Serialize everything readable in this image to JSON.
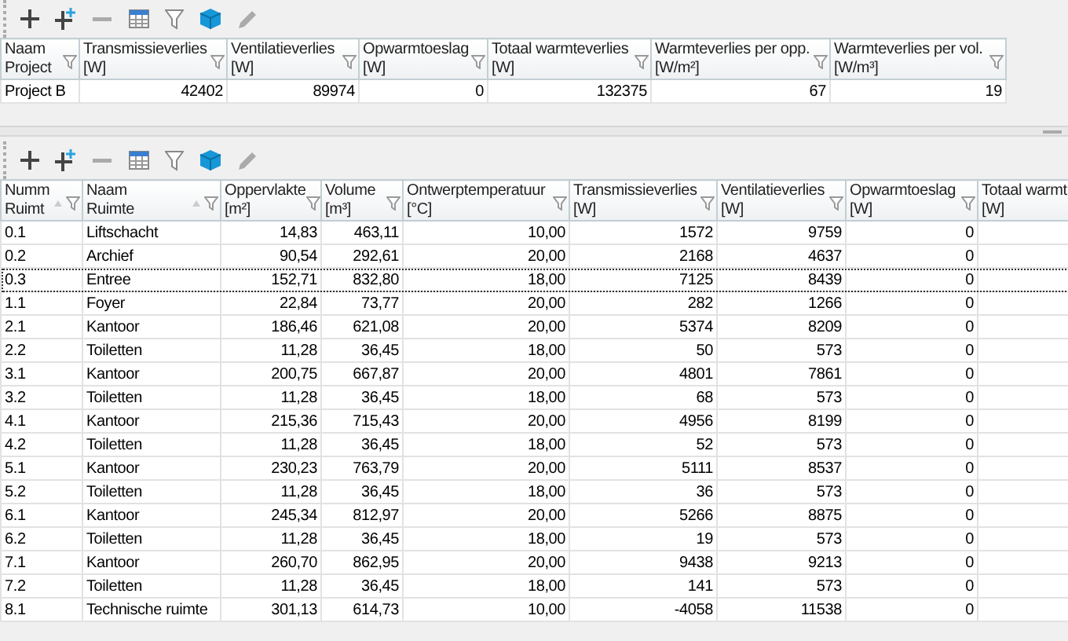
{
  "project_table": {
    "columns": [
      {
        "title": "Naam",
        "unit": "Project",
        "kind": "text",
        "sorted": false
      },
      {
        "title": "Transmissieverlies",
        "unit": "[W]",
        "kind": "number",
        "sorted": false
      },
      {
        "title": "Ventilatieverlies",
        "unit": "[W]",
        "kind": "number",
        "sorted": false
      },
      {
        "title": "Opwarmtoeslag",
        "unit": "[W]",
        "kind": "number",
        "sorted": false
      },
      {
        "title": "Totaal warmteverlies",
        "unit": "[W]",
        "kind": "number",
        "sorted": false
      },
      {
        "title": "Warmteverlies per opp.",
        "unit": "[W/m²]",
        "kind": "number",
        "sorted": false
      },
      {
        "title": "Warmteverlies per vol.",
        "unit": "[W/m³]",
        "kind": "number",
        "sorted": false
      }
    ],
    "rows": [
      {
        "selected": false,
        "cells": [
          "Project B",
          "42402",
          "89974",
          "0",
          "132375",
          "67",
          "19"
        ]
      }
    ]
  },
  "room_table": {
    "columns": [
      {
        "title": "Numm",
        "unit": "Ruimt",
        "kind": "text",
        "sorted": true
      },
      {
        "title": "Naam",
        "unit": "Ruimte",
        "kind": "text",
        "sorted": true
      },
      {
        "title": "Oppervlakte",
        "unit": "[m²]",
        "kind": "number",
        "sorted": false
      },
      {
        "title": "Volume",
        "unit": "[m³]",
        "kind": "number",
        "sorted": false
      },
      {
        "title": "Ontwerptemperatuur",
        "unit": "[°C]",
        "kind": "number",
        "sorted": false
      },
      {
        "title": "Transmissieverlies",
        "unit": "[W]",
        "kind": "number",
        "sorted": false
      },
      {
        "title": "Ventilatieverlies",
        "unit": "[W]",
        "kind": "number",
        "sorted": false
      },
      {
        "title": "Opwarmtoeslag",
        "unit": "[W]",
        "kind": "number",
        "sorted": false
      },
      {
        "title": "Totaal warmt",
        "unit": "[W]",
        "kind": "cut"
      }
    ],
    "rows": [
      {
        "selected": false,
        "cells": [
          "0.1",
          "Liftschacht",
          "14,83",
          "463,11",
          "10,00",
          "1572",
          "9759",
          "0"
        ]
      },
      {
        "selected": false,
        "cells": [
          "0.2",
          "Archief",
          "90,54",
          "292,61",
          "20,00",
          "2168",
          "4637",
          "0"
        ]
      },
      {
        "selected": true,
        "cells": [
          "0.3",
          "Entree",
          "152,71",
          "832,80",
          "18,00",
          "7125",
          "8439",
          "0"
        ]
      },
      {
        "selected": false,
        "cells": [
          "1.1",
          "Foyer",
          "22,84",
          "73,77",
          "20,00",
          "282",
          "1266",
          "0"
        ]
      },
      {
        "selected": false,
        "cells": [
          "2.1",
          "Kantoor",
          "186,46",
          "621,08",
          "20,00",
          "5374",
          "8209",
          "0"
        ]
      },
      {
        "selected": false,
        "cells": [
          "2.2",
          "Toiletten",
          "11,28",
          "36,45",
          "18,00",
          "50",
          "573",
          "0"
        ]
      },
      {
        "selected": false,
        "cells": [
          "3.1",
          "Kantoor",
          "200,75",
          "667,87",
          "20,00",
          "4801",
          "7861",
          "0"
        ]
      },
      {
        "selected": false,
        "cells": [
          "3.2",
          "Toiletten",
          "11,28",
          "36,45",
          "18,00",
          "68",
          "573",
          "0"
        ]
      },
      {
        "selected": false,
        "cells": [
          "4.1",
          "Kantoor",
          "215,36",
          "715,43",
          "20,00",
          "4956",
          "8199",
          "0"
        ]
      },
      {
        "selected": false,
        "cells": [
          "4.2",
          "Toiletten",
          "11,28",
          "36,45",
          "18,00",
          "52",
          "573",
          "0"
        ]
      },
      {
        "selected": false,
        "cells": [
          "5.1",
          "Kantoor",
          "230,23",
          "763,79",
          "20,00",
          "5111",
          "8537",
          "0"
        ]
      },
      {
        "selected": false,
        "cells": [
          "5.2",
          "Toiletten",
          "11,28",
          "36,45",
          "18,00",
          "36",
          "573",
          "0"
        ]
      },
      {
        "selected": false,
        "cells": [
          "6.1",
          "Kantoor",
          "245,34",
          "812,97",
          "20,00",
          "5266",
          "8875",
          "0"
        ]
      },
      {
        "selected": false,
        "cells": [
          "6.2",
          "Toiletten",
          "11,28",
          "36,45",
          "18,00",
          "19",
          "573",
          "0"
        ]
      },
      {
        "selected": false,
        "cells": [
          "7.1",
          "Kantoor",
          "260,70",
          "862,95",
          "20,00",
          "9438",
          "9213",
          "0"
        ]
      },
      {
        "selected": false,
        "cells": [
          "7.2",
          "Toiletten",
          "11,28",
          "36,45",
          "18,00",
          "141",
          "573",
          "0"
        ]
      },
      {
        "selected": false,
        "cells": [
          "8.1",
          "Technische ruimte",
          "301,13",
          "614,73",
          "10,00",
          "-4058",
          "11538",
          "0"
        ]
      }
    ]
  }
}
